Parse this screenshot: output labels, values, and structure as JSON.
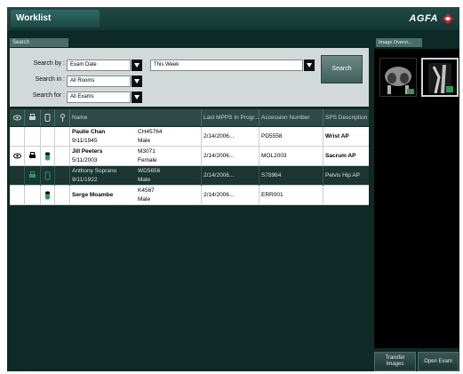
{
  "window": {
    "title": "Worklist",
    "brand": "AGFA"
  },
  "search": {
    "tab_label": "Search",
    "search_by_label": "Search by :",
    "search_by_value": "Exam Date",
    "period_value": "This Week",
    "search_in_label": "Search in :",
    "search_in_value": "All Rooms",
    "search_for_label": "Search for :",
    "search_for_value": "All Exams",
    "search_button": "Search"
  },
  "preview": {
    "tab_label": "Image Overvi..."
  },
  "columns": {
    "name": "Name",
    "last_mpps": "Last MPPS In Progr...",
    "accession": "Accession Number",
    "sps": "SPS Description"
  },
  "rows": [
    {
      "name": "Paulie Chan",
      "dob": "9/11/1945",
      "id": "CH45764",
      "sex": "Male",
      "date": "2/14/2006...",
      "accession": "PD5558",
      "sps": "Wrist AP"
    },
    {
      "name": "Jill Peeters",
      "dob": "5/11/2003",
      "id": "M3071",
      "sex": "Female",
      "date": "2/14/2006...",
      "accession": "MOL2003",
      "sps": "Sacrum AP"
    },
    {
      "name": "Anthony Soprano",
      "dob": "9/11/1922",
      "id": "WD5656",
      "sex": "Male",
      "date": "2/14/2006...",
      "accession": "S78964",
      "sps": "Pelvis Hip AP"
    },
    {
      "name": "Serge Moambe",
      "dob": "",
      "id": "K4567",
      "sex": "Male",
      "date": "2/14/2006...",
      "accession": "ERR001",
      "sps": ""
    }
  ],
  "buttons": {
    "transfer_line1": "Transfer",
    "transfer_line2": "Images",
    "open_exam": "Open Exam"
  },
  "colors": {
    "background": "#0d2a27",
    "panel": "#d2dad9",
    "selected_row": "#1a3532",
    "brand_red": "#d8222a",
    "status_green": "#2e9a55"
  }
}
